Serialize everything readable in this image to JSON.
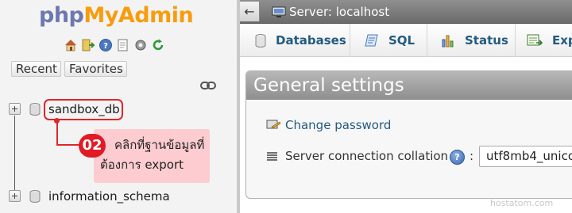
{
  "nav": {
    "logo": {
      "part1": "php",
      "part2": "MyAdmin"
    },
    "toolbar_icons": [
      "home-icon",
      "logout-icon",
      "help-icon",
      "docs-icon",
      "settings-icon",
      "reload-icon"
    ],
    "recent_label": "Recent",
    "favorites_label": "Favorites",
    "link_icon": "chain-link-icon",
    "databases": [
      {
        "name": "sandbox_db"
      },
      {
        "name": "information_schema"
      }
    ]
  },
  "annotation": {
    "badge": "02",
    "text": "คลิกที่ฐานข้อมูลที่ต้องการ export"
  },
  "header": {
    "back_label": "←",
    "server_label": "Server: localhost"
  },
  "tabs": [
    {
      "label": "Databases"
    },
    {
      "label": "SQL"
    },
    {
      "label": "Status"
    },
    {
      "label": "Exp"
    }
  ],
  "general_settings": {
    "title": "General settings",
    "change_password_label": "Change password",
    "collation_label": "Server connection collation",
    "help_label": "?",
    "colon": ":",
    "collation_value": "utf8mb4_unico"
  },
  "watermark": "hostatom.com",
  "colors": {
    "accent_link": "#235a81",
    "logo_blue": "#6c78af",
    "logo_orange": "#f89c0e",
    "annotation_red": "#e0252b",
    "annotation_bg": "#fcccd0"
  }
}
